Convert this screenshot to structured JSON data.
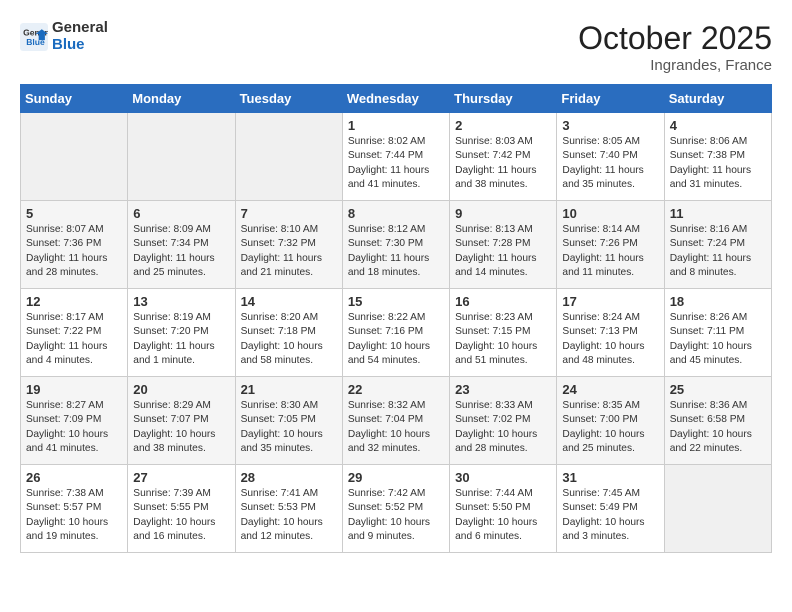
{
  "header": {
    "logo_line1": "General",
    "logo_line2": "Blue",
    "month": "October 2025",
    "location": "Ingrandes, France"
  },
  "weekdays": [
    "Sunday",
    "Monday",
    "Tuesday",
    "Wednesday",
    "Thursday",
    "Friday",
    "Saturday"
  ],
  "weeks": [
    [
      {
        "day": "",
        "text": ""
      },
      {
        "day": "",
        "text": ""
      },
      {
        "day": "",
        "text": ""
      },
      {
        "day": "1",
        "text": "Sunrise: 8:02 AM\nSunset: 7:44 PM\nDaylight: 11 hours\nand 41 minutes."
      },
      {
        "day": "2",
        "text": "Sunrise: 8:03 AM\nSunset: 7:42 PM\nDaylight: 11 hours\nand 38 minutes."
      },
      {
        "day": "3",
        "text": "Sunrise: 8:05 AM\nSunset: 7:40 PM\nDaylight: 11 hours\nand 35 minutes."
      },
      {
        "day": "4",
        "text": "Sunrise: 8:06 AM\nSunset: 7:38 PM\nDaylight: 11 hours\nand 31 minutes."
      }
    ],
    [
      {
        "day": "5",
        "text": "Sunrise: 8:07 AM\nSunset: 7:36 PM\nDaylight: 11 hours\nand 28 minutes."
      },
      {
        "day": "6",
        "text": "Sunrise: 8:09 AM\nSunset: 7:34 PM\nDaylight: 11 hours\nand 25 minutes."
      },
      {
        "day": "7",
        "text": "Sunrise: 8:10 AM\nSunset: 7:32 PM\nDaylight: 11 hours\nand 21 minutes."
      },
      {
        "day": "8",
        "text": "Sunrise: 8:12 AM\nSunset: 7:30 PM\nDaylight: 11 hours\nand 18 minutes."
      },
      {
        "day": "9",
        "text": "Sunrise: 8:13 AM\nSunset: 7:28 PM\nDaylight: 11 hours\nand 14 minutes."
      },
      {
        "day": "10",
        "text": "Sunrise: 8:14 AM\nSunset: 7:26 PM\nDaylight: 11 hours\nand 11 minutes."
      },
      {
        "day": "11",
        "text": "Sunrise: 8:16 AM\nSunset: 7:24 PM\nDaylight: 11 hours\nand 8 minutes."
      }
    ],
    [
      {
        "day": "12",
        "text": "Sunrise: 8:17 AM\nSunset: 7:22 PM\nDaylight: 11 hours\nand 4 minutes."
      },
      {
        "day": "13",
        "text": "Sunrise: 8:19 AM\nSunset: 7:20 PM\nDaylight: 11 hours\nand 1 minute."
      },
      {
        "day": "14",
        "text": "Sunrise: 8:20 AM\nSunset: 7:18 PM\nDaylight: 10 hours\nand 58 minutes."
      },
      {
        "day": "15",
        "text": "Sunrise: 8:22 AM\nSunset: 7:16 PM\nDaylight: 10 hours\nand 54 minutes."
      },
      {
        "day": "16",
        "text": "Sunrise: 8:23 AM\nSunset: 7:15 PM\nDaylight: 10 hours\nand 51 minutes."
      },
      {
        "day": "17",
        "text": "Sunrise: 8:24 AM\nSunset: 7:13 PM\nDaylight: 10 hours\nand 48 minutes."
      },
      {
        "day": "18",
        "text": "Sunrise: 8:26 AM\nSunset: 7:11 PM\nDaylight: 10 hours\nand 45 minutes."
      }
    ],
    [
      {
        "day": "19",
        "text": "Sunrise: 8:27 AM\nSunset: 7:09 PM\nDaylight: 10 hours\nand 41 minutes."
      },
      {
        "day": "20",
        "text": "Sunrise: 8:29 AM\nSunset: 7:07 PM\nDaylight: 10 hours\nand 38 minutes."
      },
      {
        "day": "21",
        "text": "Sunrise: 8:30 AM\nSunset: 7:05 PM\nDaylight: 10 hours\nand 35 minutes."
      },
      {
        "day": "22",
        "text": "Sunrise: 8:32 AM\nSunset: 7:04 PM\nDaylight: 10 hours\nand 32 minutes."
      },
      {
        "day": "23",
        "text": "Sunrise: 8:33 AM\nSunset: 7:02 PM\nDaylight: 10 hours\nand 28 minutes."
      },
      {
        "day": "24",
        "text": "Sunrise: 8:35 AM\nSunset: 7:00 PM\nDaylight: 10 hours\nand 25 minutes."
      },
      {
        "day": "25",
        "text": "Sunrise: 8:36 AM\nSunset: 6:58 PM\nDaylight: 10 hours\nand 22 minutes."
      }
    ],
    [
      {
        "day": "26",
        "text": "Sunrise: 7:38 AM\nSunset: 5:57 PM\nDaylight: 10 hours\nand 19 minutes."
      },
      {
        "day": "27",
        "text": "Sunrise: 7:39 AM\nSunset: 5:55 PM\nDaylight: 10 hours\nand 16 minutes."
      },
      {
        "day": "28",
        "text": "Sunrise: 7:41 AM\nSunset: 5:53 PM\nDaylight: 10 hours\nand 12 minutes."
      },
      {
        "day": "29",
        "text": "Sunrise: 7:42 AM\nSunset: 5:52 PM\nDaylight: 10 hours\nand 9 minutes."
      },
      {
        "day": "30",
        "text": "Sunrise: 7:44 AM\nSunset: 5:50 PM\nDaylight: 10 hours\nand 6 minutes."
      },
      {
        "day": "31",
        "text": "Sunrise: 7:45 AM\nSunset: 5:49 PM\nDaylight: 10 hours\nand 3 minutes."
      },
      {
        "day": "",
        "text": ""
      }
    ]
  ]
}
